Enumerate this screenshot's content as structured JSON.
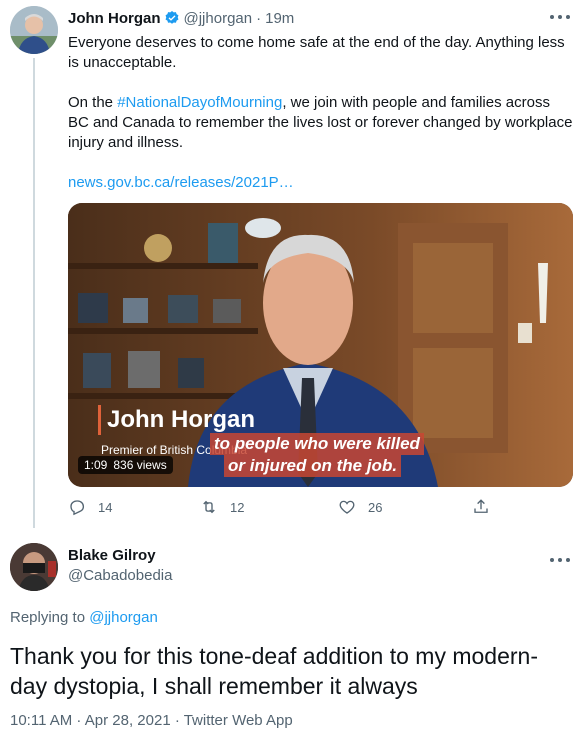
{
  "tweet": {
    "author_name": "John Horgan",
    "handle": "@jjhorgan",
    "separator": "·",
    "time": "19m",
    "paragraph1": "Everyone deserves to come home safe at the end of the day. Anything less is unacceptable.",
    "paragraph2_prefix": "On the ",
    "hashtag": "#NationalDayofMourning",
    "paragraph2_suffix": ", we join with people and families across BC and Canada to remember the lives lost or forever changed by workplace injury and illness.",
    "link": "news.gov.bc.ca/releases/2021P…",
    "video": {
      "lower_third_name": "John Horgan",
      "lower_third_title": "Premier of British Columbia",
      "caption_line1": "to people who were killed",
      "caption_line2": "or injured on the job.",
      "duration": "1:09",
      "views": "836 views"
    },
    "actions": {
      "replies": "14",
      "retweets": "12",
      "likes": "26"
    }
  },
  "reply": {
    "author_name": "Blake Gilroy",
    "handle": "@Cabadobedia",
    "replying_prefix": "Replying to ",
    "replying_to": "@jjhorgan",
    "text": "Thank you for this tone-deaf addition to my modern-day dystopia, I shall remember it always",
    "meta": "10:11 AM · Apr 28, 2021 · Twitter Web App"
  },
  "icons": {
    "verified": "verified-badge-icon",
    "more": "more-icon",
    "reply": "reply-icon",
    "retweet": "retweet-icon",
    "like": "heart-icon",
    "share": "share-icon"
  },
  "colors": {
    "link": "#1d9bf0",
    "secondary_text": "#536471",
    "primary_text": "#0f1419"
  }
}
